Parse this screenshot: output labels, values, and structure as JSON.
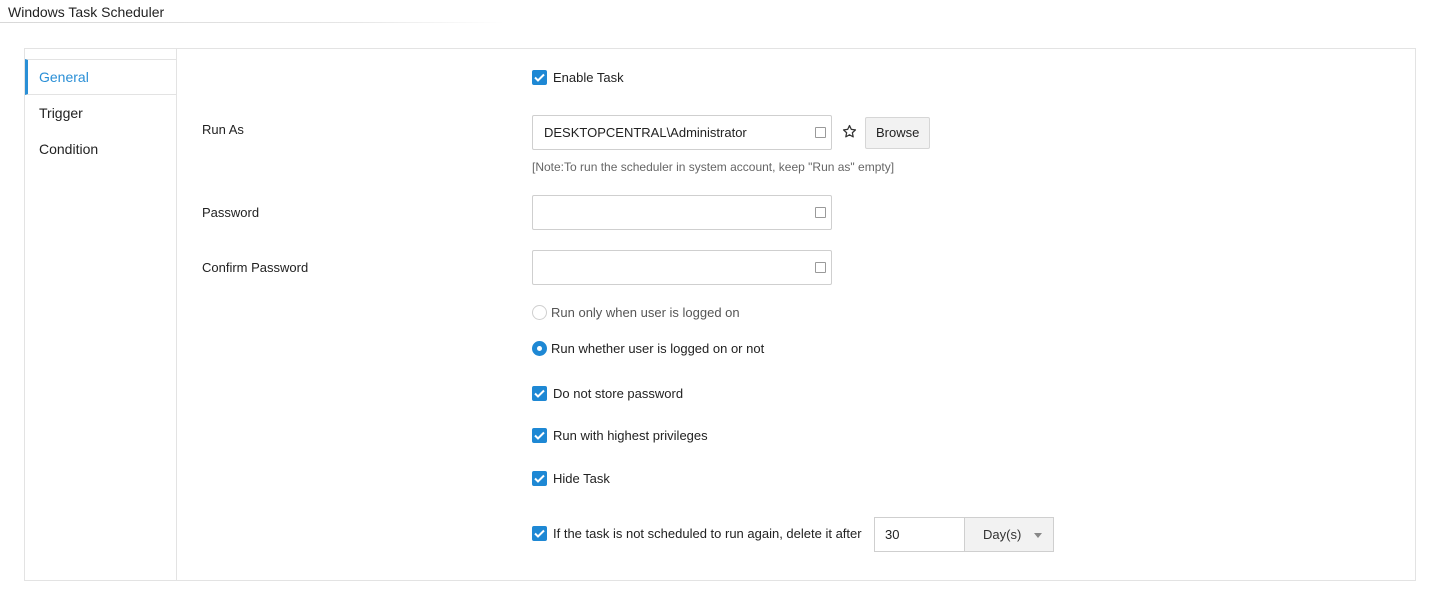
{
  "header": {
    "title": "Windows Task Scheduler"
  },
  "sidebar": {
    "items": [
      {
        "label": "General",
        "active": true
      },
      {
        "label": "Trigger",
        "active": false
      },
      {
        "label": "Condition",
        "active": false
      }
    ]
  },
  "general": {
    "enable_task": {
      "label": "Enable Task",
      "checked": true
    },
    "run_as": {
      "label": "Run As",
      "value": "DESKTOPCENTRAL\\Administrator",
      "browse_label": "Browse",
      "note": "[Note:To run the scheduler in system account, keep \"Run as\" empty]"
    },
    "password": {
      "label": "Password",
      "value": ""
    },
    "confirm_password": {
      "label": "Confirm Password",
      "value": ""
    },
    "run_mode": {
      "options": [
        {
          "label": "Run only when user is logged on",
          "selected": false
        },
        {
          "label": "Run whether user is logged on or not",
          "selected": true
        }
      ]
    },
    "do_not_store_password": {
      "label": "Do not store password",
      "checked": true
    },
    "highest_privileges": {
      "label": "Run with highest privileges",
      "checked": true
    },
    "hide_task": {
      "label": "Hide Task",
      "checked": true
    },
    "delete_after": {
      "label": "If the task is not scheduled to run again, delete it after",
      "checked": true,
      "value": "30",
      "unit": "Day(s)"
    }
  },
  "colors": {
    "accent": "#1e88d4",
    "active_tab": "#2a8fd6",
    "border": "#e3e3e3"
  }
}
